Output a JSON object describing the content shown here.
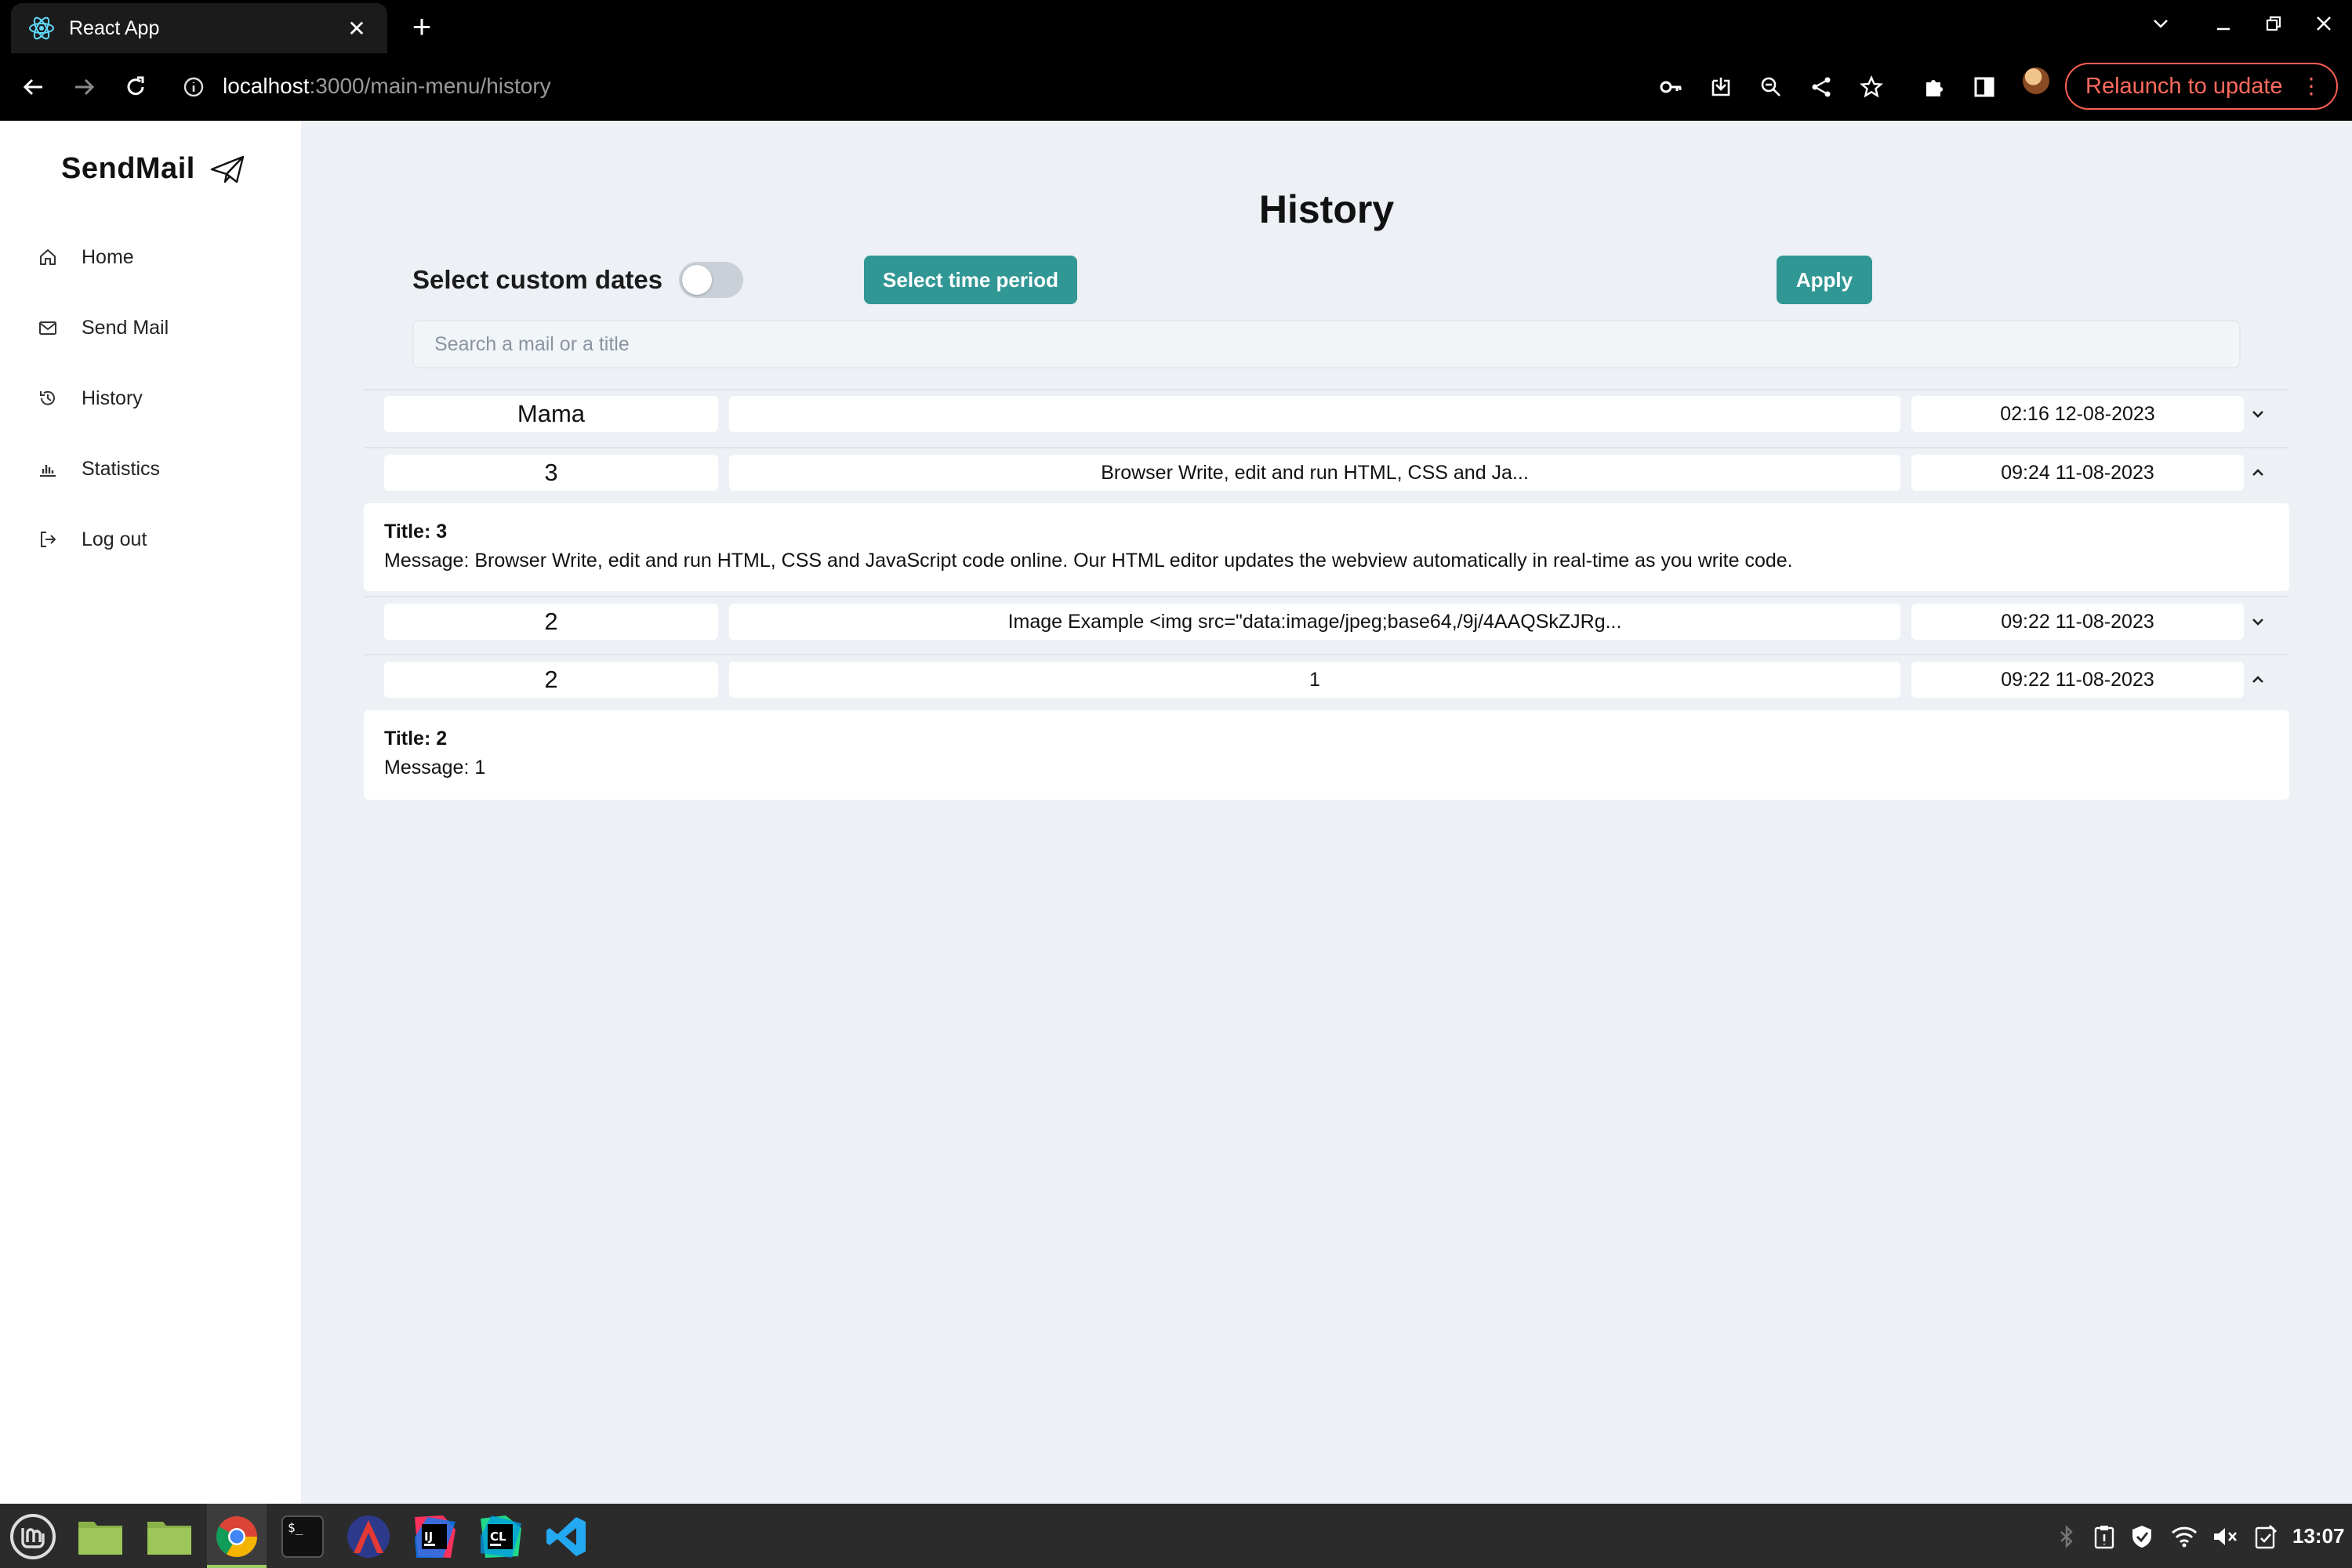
{
  "browser": {
    "tab_title": "React App",
    "url_host": "localhost",
    "url_path": ":3000/main-menu/history",
    "relaunch_label": "Relaunch to update"
  },
  "sidebar": {
    "brand": "SendMail",
    "items": [
      {
        "label": "Home",
        "icon": "home-icon"
      },
      {
        "label": "Send Mail",
        "icon": "mail-icon"
      },
      {
        "label": "History",
        "icon": "history-icon"
      },
      {
        "label": "Statistics",
        "icon": "bar-chart-icon"
      },
      {
        "label": "Log out",
        "icon": "logout-icon"
      }
    ]
  },
  "main": {
    "title": "History",
    "custom_dates_label": "Select custom dates",
    "custom_dates_enabled": false,
    "select_period_label": "Select time period",
    "apply_label": "Apply",
    "search_placeholder": "Search a mail or a title",
    "rows": [
      {
        "title": "Mama",
        "message": "",
        "date": "02:16 12-08-2023",
        "expanded": false
      },
      {
        "title": "3",
        "message": "Browser Write, edit and run HTML, CSS and Ja...",
        "date": "09:24 11-08-2023",
        "expanded": true,
        "detail_title": "Title: 3",
        "detail_message": "Message: Browser Write, edit and run HTML, CSS and JavaScript code online. Our HTML editor updates the webview automatically in real-time as you write code."
      },
      {
        "title": "2",
        "message": "Image Example <img src=\"data:image/jpeg;base64,/9j/4AAQSkZJRg...",
        "date": "09:22 11-08-2023",
        "expanded": false
      },
      {
        "title": "2",
        "message": "1",
        "date": "09:22 11-08-2023",
        "expanded": true,
        "detail_title": "Title: 2",
        "detail_message": "Message: 1"
      }
    ]
  },
  "taskbar": {
    "clock": "13:07"
  },
  "colors": {
    "accent": "#319795",
    "page_bg": "#edf1f5",
    "relaunch": "#ff5f57"
  }
}
